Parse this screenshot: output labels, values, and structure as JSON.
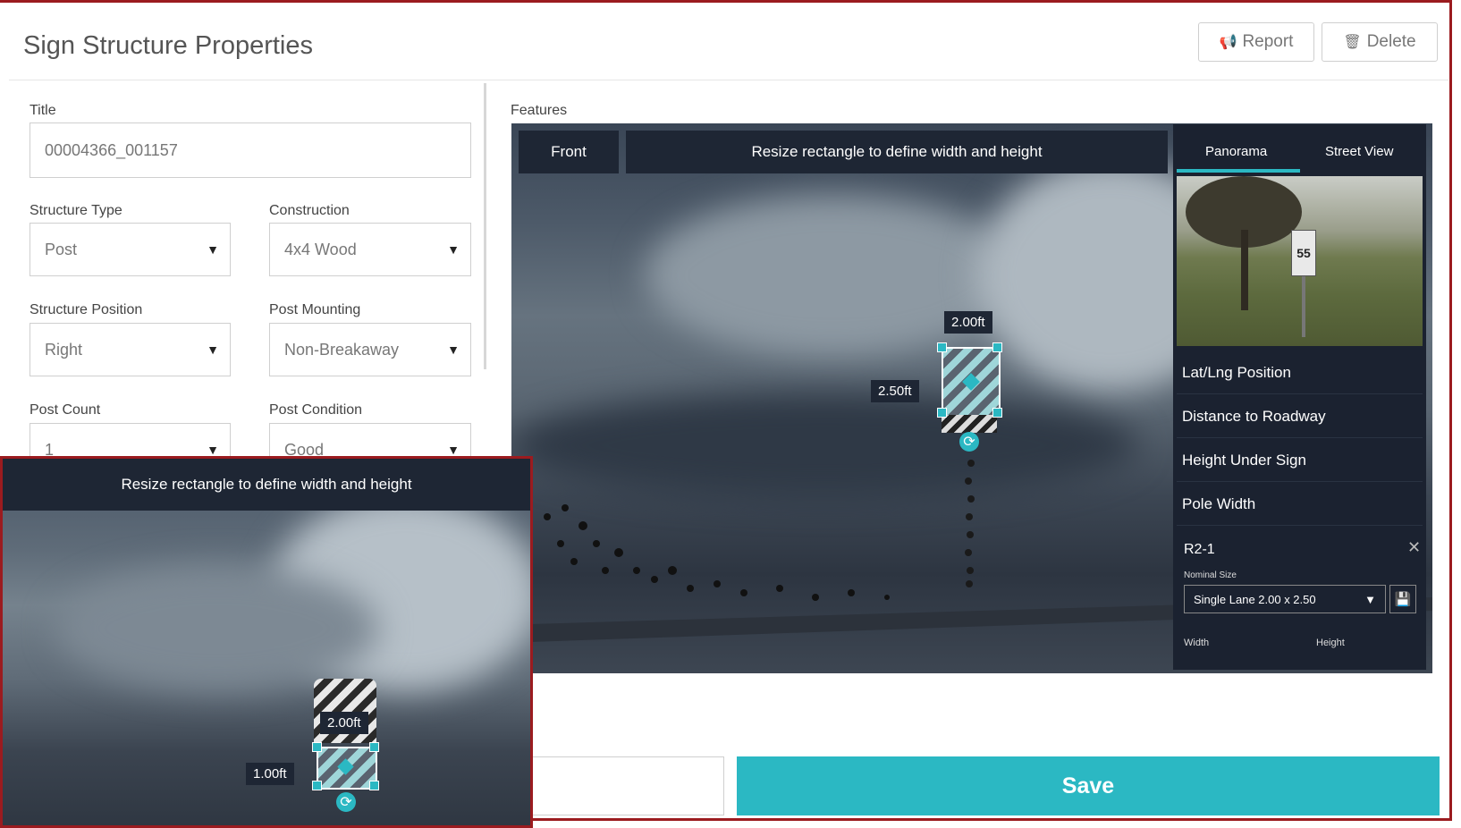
{
  "header": {
    "title": "Sign Structure Properties",
    "report_label": "Report",
    "delete_label": "Delete"
  },
  "form": {
    "title_label": "Title",
    "title_value": "00004366_001157",
    "structure_type_label": "Structure Type",
    "structure_type_value": "Post",
    "construction_label": "Construction",
    "construction_value": "4x4 Wood",
    "structure_position_label": "Structure Position",
    "structure_position_value": "Right",
    "post_mounting_label": "Post Mounting",
    "post_mounting_value": "Non-Breakaway",
    "post_count_label": "Post Count",
    "post_count_value": "1",
    "post_condition_label": "Post Condition",
    "post_condition_value": "Good"
  },
  "features": {
    "label": "Features",
    "view_label": "Front",
    "instruction": "Resize rectangle to define width and height",
    "width_readout": "2.00ft",
    "height_readout": "2.50ft"
  },
  "side_panel": {
    "tabs": [
      "Panorama",
      "Street View"
    ],
    "menu": [
      "Lat/Lng Position",
      "Distance to Roadway",
      "Height Under Sign",
      "Pole Width"
    ],
    "sign_code": "R2-1",
    "nominal_size_label": "Nominal Size",
    "nominal_size_value": "Single Lane 2.00 x 2.50",
    "width_label": "Width",
    "height_label": "Height",
    "speed_sign_text": "55"
  },
  "inset": {
    "instruction": "Resize rectangle to define width and height",
    "width_readout": "2.00ft",
    "height_readout": "1.00ft"
  },
  "footer": {
    "save_label": "Save"
  },
  "colors": {
    "accent": "#2bb8c3",
    "dark_panel": "#1b2230",
    "border_red": "#9b1b1f"
  }
}
